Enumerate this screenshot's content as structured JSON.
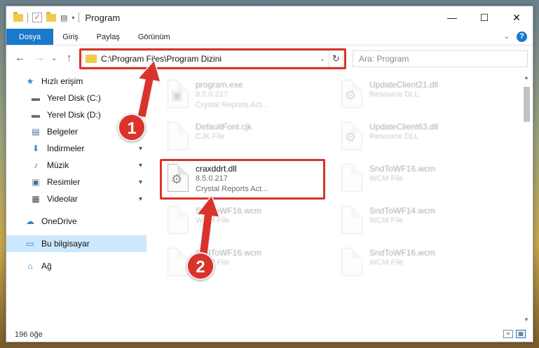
{
  "window": {
    "title": "Program",
    "controls": {
      "minimize": "—",
      "maximize": "☐",
      "close": "✕"
    }
  },
  "quick_access": {
    "check_glyph": "✓",
    "props_glyph": "▤",
    "dropdown_glyph": "▾"
  },
  "ribbon": {
    "tabs": [
      "Dosya",
      "Giriş",
      "Paylaş",
      "Görünüm"
    ],
    "help": "?",
    "collapse": "⌄"
  },
  "address": {
    "path": "C:\\Program Files\\Program Dizini",
    "dropdown": "⌄",
    "refresh": "↻",
    "back": "←",
    "forward": "→",
    "recent": "⌄",
    "up": "↑"
  },
  "search": {
    "placeholder": "Ara: Program"
  },
  "sidebar": {
    "items": [
      {
        "label": "Hızlı erişim",
        "icon": "★",
        "pin": false
      },
      {
        "label": "Yerel Disk (C:)",
        "icon": "▬",
        "pin": false
      },
      {
        "label": "Yerel Disk (D:)",
        "icon": "▬",
        "pin": false
      },
      {
        "label": "Belgeler",
        "icon": "▤",
        "pin": false
      },
      {
        "label": "İndirmeler",
        "icon": "⬇",
        "pin": true
      },
      {
        "label": "Müzik",
        "icon": "♪",
        "pin": true
      },
      {
        "label": "Resimler",
        "icon": "▣",
        "pin": true
      },
      {
        "label": "Videolar",
        "icon": "▦",
        "pin": true
      },
      {
        "label": "OneDrive",
        "icon": "☁",
        "pin": false
      },
      {
        "label": "Bu bilgisayar",
        "icon": "▭",
        "pin": false
      },
      {
        "label": "Ağ",
        "icon": "⌂",
        "pin": false
      }
    ],
    "pin_glyph": "📌"
  },
  "files": [
    {
      "name": "program.exe",
      "line1": "8.5.0.217",
      "line2": "Crystal Reports Act...",
      "faded": true
    },
    {
      "name": "DefaultFont.cjk",
      "line1": "CJK File",
      "line2": "",
      "faded": true
    },
    {
      "name": "craxddrt.dll",
      "line1": "8.5.0.217",
      "line2": "Crystal Reports Act...",
      "faded": false
    },
    {
      "name": "SndToWF16.wcm",
      "line1": "WCM File",
      "line2": "",
      "faded": true
    },
    {
      "name": "SndToWF16.wcm",
      "line1": "WCM File",
      "line2": "",
      "faded": true
    },
    {
      "name": "UpdateClient21.dll",
      "line1": "Resource DLL",
      "line2": "",
      "faded": true
    },
    {
      "name": "UpdateClient63.dll",
      "line1": "Resource DLL",
      "line2": "",
      "faded": true
    },
    {
      "name": "SndToWF16.wcm",
      "line1": "WCM File",
      "line2": "",
      "faded": true
    },
    {
      "name": "SndToWF14.wcm",
      "line1": "WCM File",
      "line2": "",
      "faded": true
    },
    {
      "name": "SndToWF16.wcm",
      "line1": "WCM File",
      "line2": "",
      "faded": true
    }
  ],
  "status": {
    "count": "196 öğe"
  },
  "annotations": {
    "badge1": "1",
    "badge2": "2"
  },
  "colors": {
    "accent": "#1979ca",
    "highlight": "#d9332b",
    "selection": "#cce8ff"
  }
}
